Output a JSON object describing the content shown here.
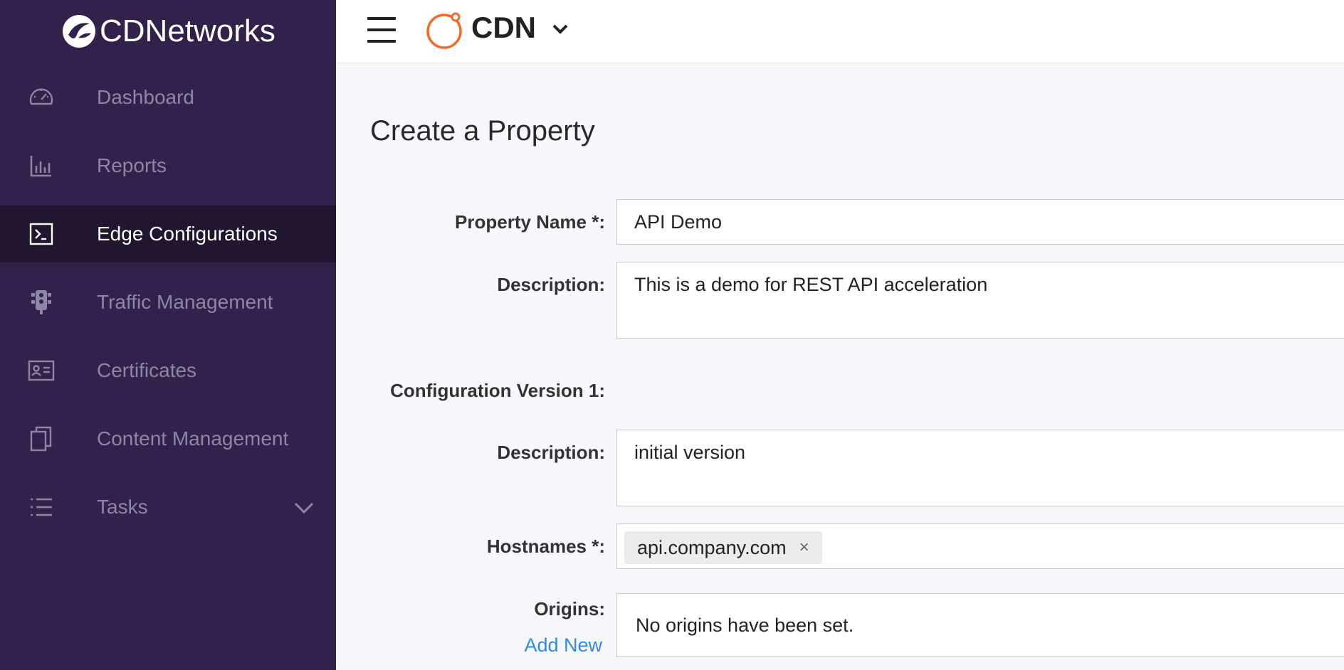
{
  "brand": {
    "name": "CDNetworks"
  },
  "sidebar": {
    "items": [
      {
        "label": "Dashboard",
        "icon": "dashboard-gauge-icon"
      },
      {
        "label": "Reports",
        "icon": "bar-chart-icon"
      },
      {
        "label": "Edge Configurations",
        "icon": "terminal-icon",
        "active": true
      },
      {
        "label": "Traffic Management",
        "icon": "traffic-light-icon"
      },
      {
        "label": "Certificates",
        "icon": "id-card-icon"
      },
      {
        "label": "Content Management",
        "icon": "copy-pages-icon"
      },
      {
        "label": "Tasks",
        "icon": "list-icon",
        "expandable": true
      }
    ]
  },
  "topbar": {
    "product": "CDN"
  },
  "page": {
    "title": "Create a Property",
    "property_name_label": "Property Name *:",
    "property_name_value": "API Demo",
    "description_label": "Description:",
    "description_value": "This is a demo for REST API acceleration",
    "config_version_label": "Configuration Version 1:",
    "version_description_label": "Description:",
    "version_description_value": "initial version",
    "hostnames_label": "Hostnames *:",
    "hostnames": [
      "api.company.com"
    ],
    "tag_remove": "×",
    "origins_label": "Origins:",
    "add_new": "Add New",
    "origins_empty": "No origins have been set."
  },
  "colors": {
    "sidebar_bg": "#31214b",
    "sidebar_active_bg": "#21152f",
    "accent_orange": "#f26b2b",
    "link_blue": "#2f8ce6"
  }
}
